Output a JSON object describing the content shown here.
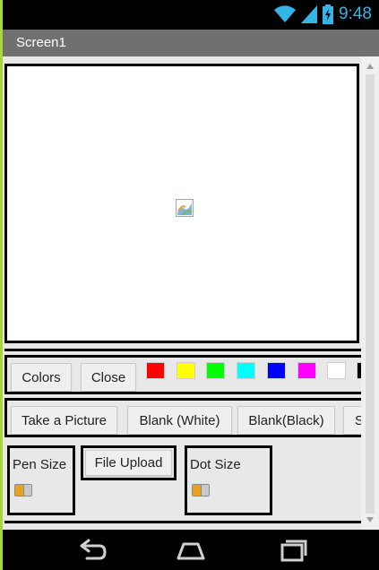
{
  "status": {
    "time": "9:48"
  },
  "app": {
    "title": "Screen1"
  },
  "toolbar_colors": {
    "colors_label": "Colors",
    "close_label": "Close",
    "swatches": [
      {
        "name": "red",
        "color": "#ff0000"
      },
      {
        "name": "yellow",
        "color": "#ffff00"
      },
      {
        "name": "green",
        "color": "#00ff00"
      },
      {
        "name": "cyan",
        "color": "#00ffff"
      },
      {
        "name": "blue",
        "color": "#0000ff"
      },
      {
        "name": "magenta",
        "color": "#ff00ff"
      },
      {
        "name": "white",
        "color": "#ffffff"
      },
      {
        "name": "black",
        "color": "#000000"
      }
    ]
  },
  "toolbar_actions": {
    "take_picture_label": "Take a Picture",
    "blank_white_label": "Blank (White)",
    "blank_black_label": "Blank(Black)",
    "truncated_label": "S"
  },
  "settings": {
    "pen_size_label": "Pen Size",
    "file_upload_label": "File Upload",
    "dot_size_label": "Dot Size"
  },
  "icons": {
    "canvas_placeholder": "broken-image-icon",
    "nav_back": "back-icon",
    "nav_home": "home-icon",
    "nav_recents": "recents-icon"
  },
  "accent_colors": {
    "status_blue": "#33b5e5",
    "titlebar": "#707070"
  }
}
